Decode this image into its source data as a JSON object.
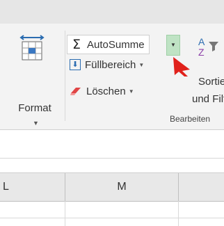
{
  "ribbon": {
    "format": {
      "label": "Format"
    },
    "editing": {
      "autosum_label": "AutoSumme",
      "fill_label": "Füllbereich",
      "clear_label": "Löschen",
      "sort_label_line1": "Sortie",
      "sort_label_line2": "und Filt",
      "group_label": "Bearbeiten"
    }
  },
  "sheet": {
    "columns": [
      "L",
      "M"
    ]
  },
  "colors": {
    "split_highlight": "#bfe3c4",
    "cursor": "#e0211b"
  },
  "icons": [
    "format-cells-icon",
    "sigma-icon",
    "fill-down-icon",
    "eraser-icon",
    "sort-filter-icon",
    "mouse-pointer-icon"
  ]
}
